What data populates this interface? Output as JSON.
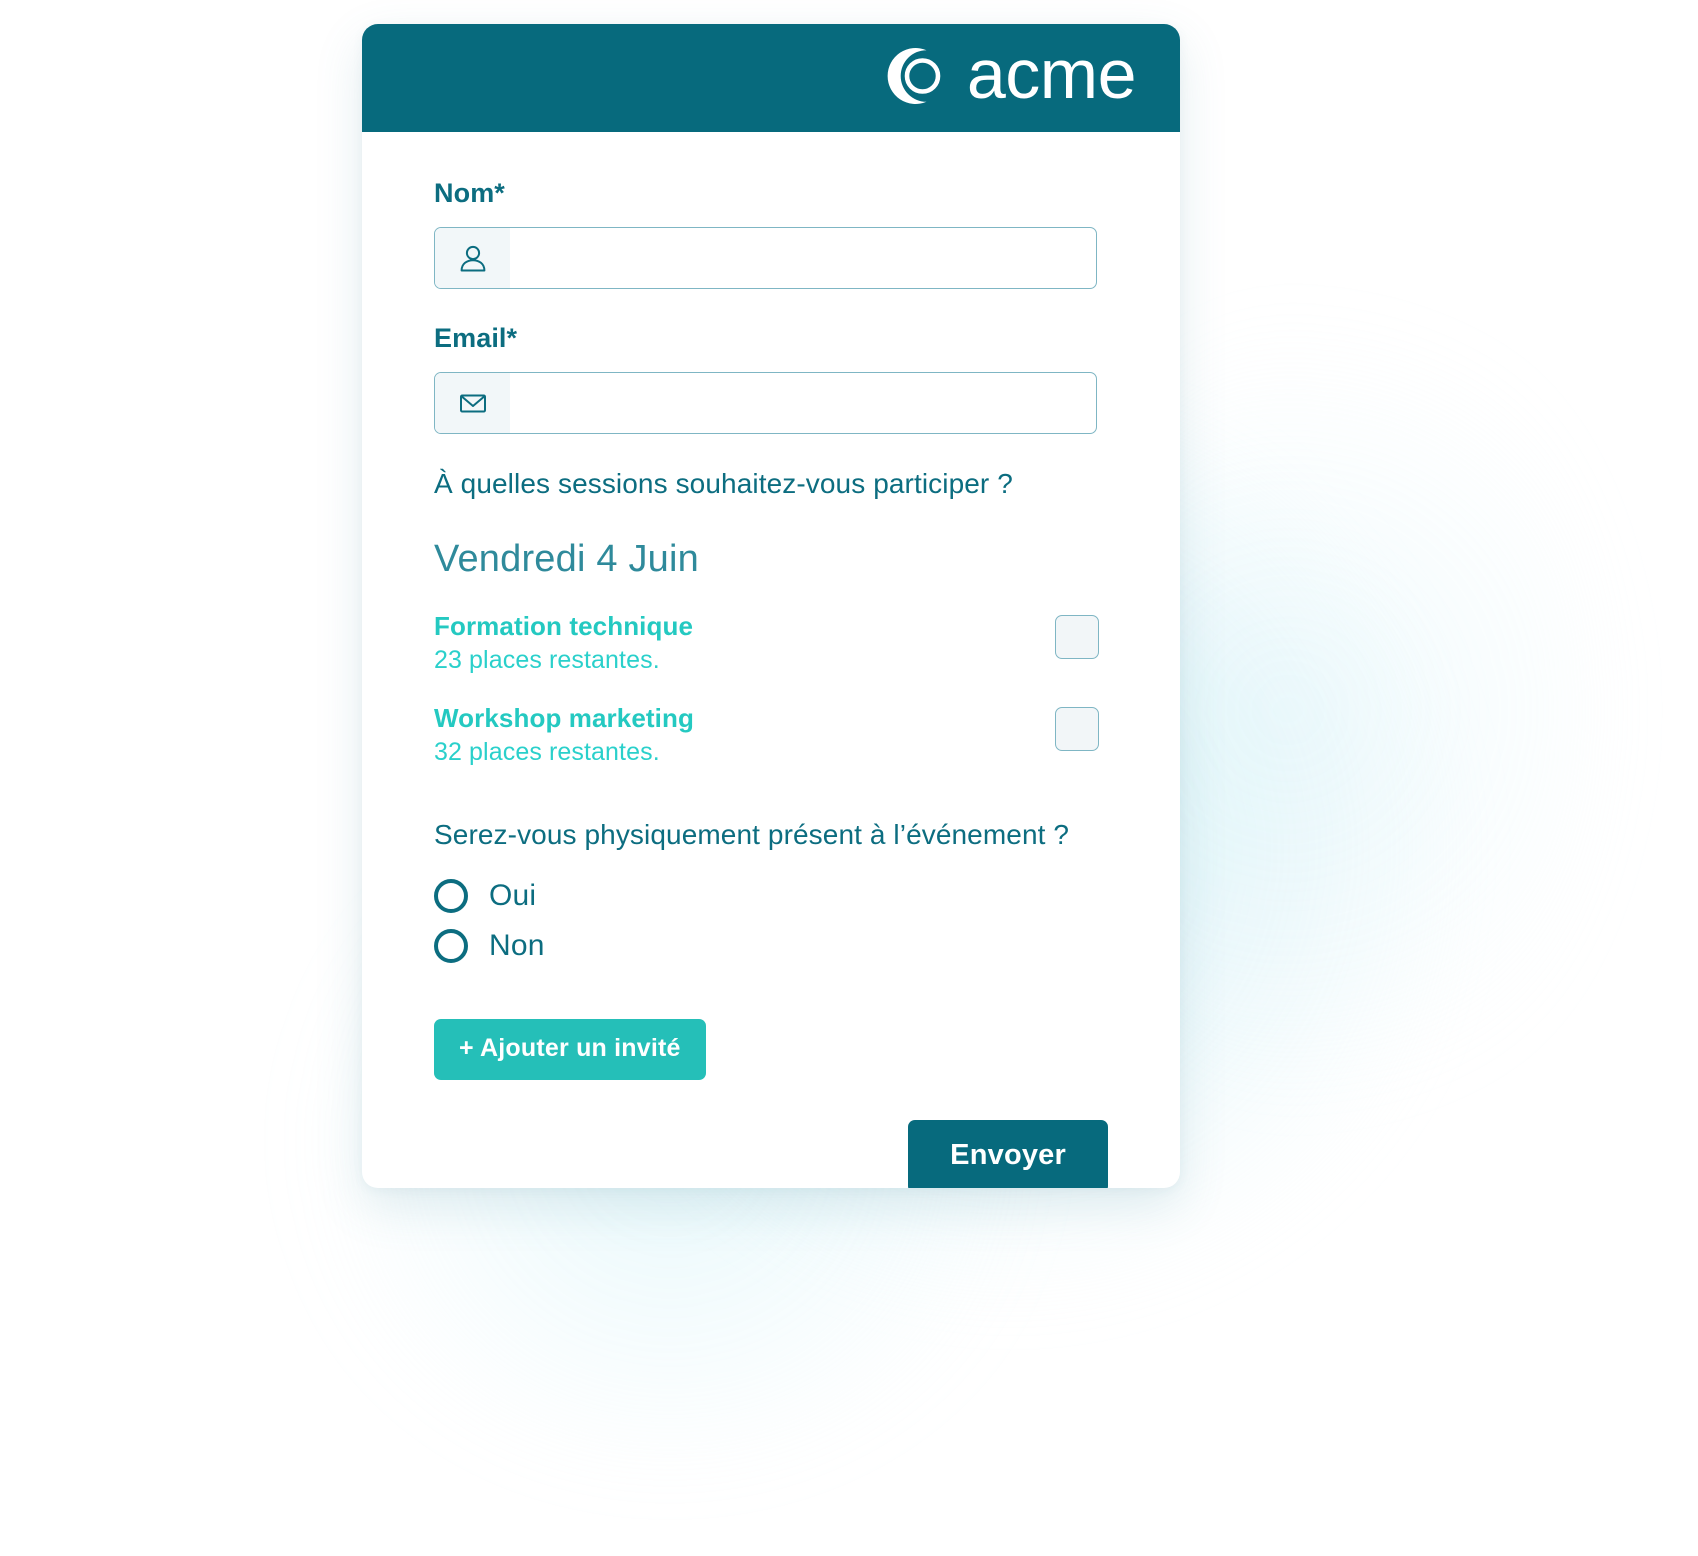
{
  "brand": {
    "name": "acme",
    "logo_icon": "crescent-circle-icon",
    "header_color": "#076a7d",
    "accent_color": "#25bfb8",
    "text_color": "#0c6d80",
    "session_color": "#24c9c1"
  },
  "form": {
    "name_field": {
      "label": "Nom*",
      "value": "",
      "placeholder": "",
      "icon": "person-icon"
    },
    "email_field": {
      "label": "Email*",
      "value": "",
      "placeholder": "",
      "icon": "envelope-icon"
    },
    "sessions_question": "À quelles sessions souhaitez-vous participer ?",
    "day_heading": "Vendredi 4 Juin",
    "sessions": [
      {
        "name": "Formation technique",
        "seats": "23 places restantes.",
        "checked": false
      },
      {
        "name": "Workshop marketing",
        "seats": "32 places restantes.",
        "checked": false
      }
    ],
    "presence_question": "Serez-vous physiquement présent à l’événement ?",
    "presence_options": [
      {
        "label": "Oui",
        "selected": false
      },
      {
        "label": "Non",
        "selected": false
      }
    ],
    "add_guest_label": "+ Ajouter un invité",
    "submit_label": "Envoyer"
  }
}
